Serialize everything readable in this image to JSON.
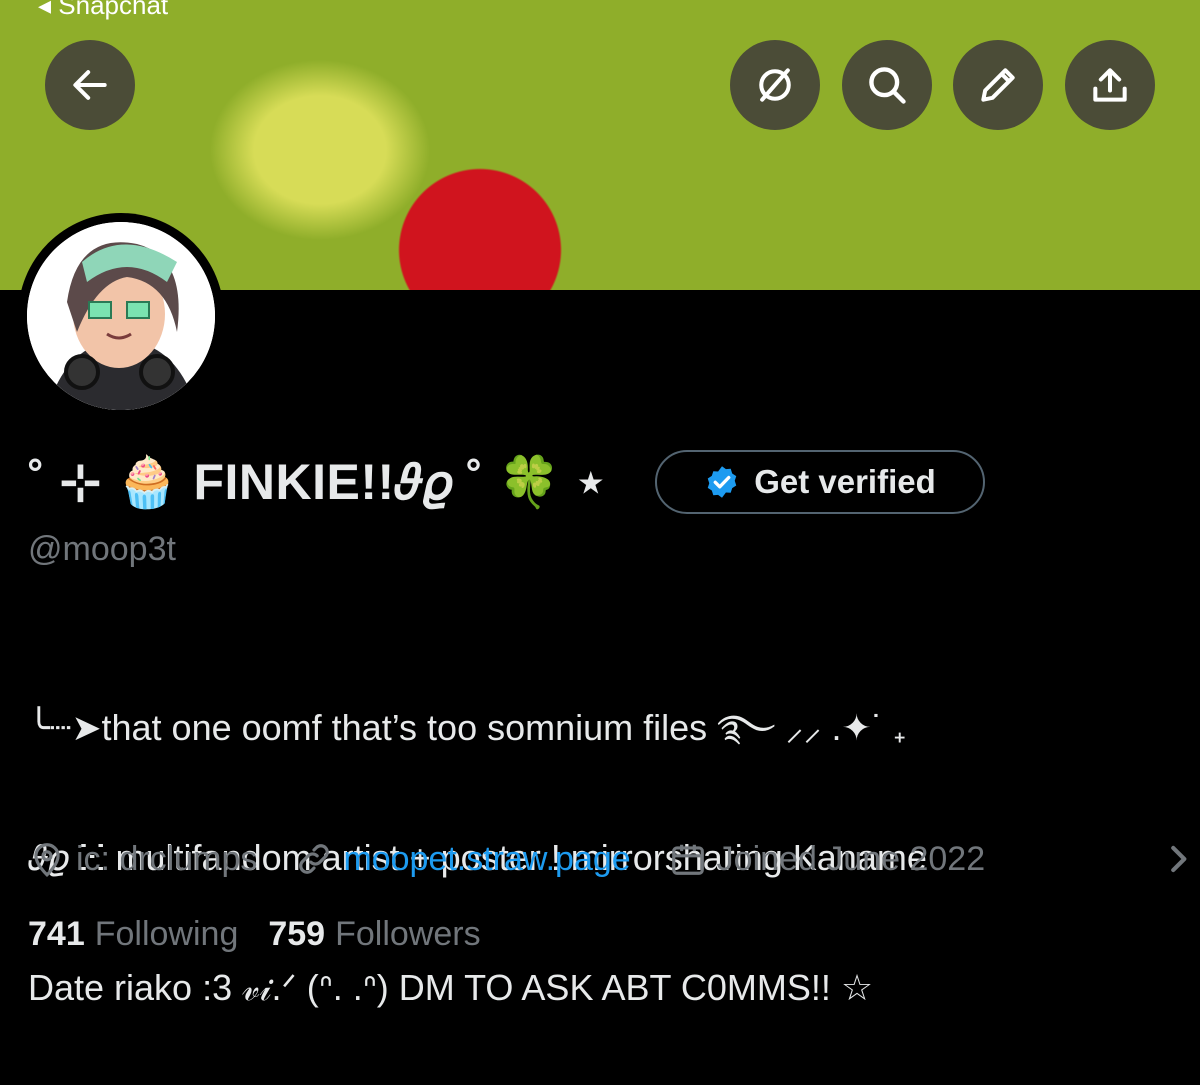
{
  "top_bar": {
    "status_text": "◂ Snapchat",
    "back_icon": "arrow-left-icon",
    "actions": [
      {
        "name": "hide-icon",
        "label": "Hide"
      },
      {
        "name": "search-icon",
        "label": "Search"
      },
      {
        "name": "edit-icon",
        "label": "Edit"
      },
      {
        "name": "share-icon",
        "label": "Share"
      }
    ]
  },
  "profile": {
    "display_name": "˚ ⊹ 🧁 FINKIE!!𝜗𝜚 ˚ 🍀 ⋆",
    "handle": "@moop3t",
    "verify_label": "Get verified",
    "bio_lines": [
      "╰┈➤that one oomf that’s too somnium files ࿐ ⸝⸝ .✦˙ ₊",
      "𝜗𝜚 ⵘ multifandom artist + poster ! mirrorsharing Kaname",
      "Date riako :3 𝓋𝒾.ᐟ (ᐢ. .ᐢ) DM TO ASK ABT C0MMS!! ☆"
    ],
    "location": "ic: drclumps",
    "website": "moopet.straw.page",
    "joined": "Joined June 2022",
    "following_count": "741",
    "following_label": "Following",
    "followers_count": "759",
    "followers_label": "Followers"
  },
  "colors": {
    "background": "#000000",
    "text": "#e7e9ea",
    "muted": "#71767b",
    "link": "#1d9bf0",
    "verified_badge": "#1d9bf0"
  }
}
